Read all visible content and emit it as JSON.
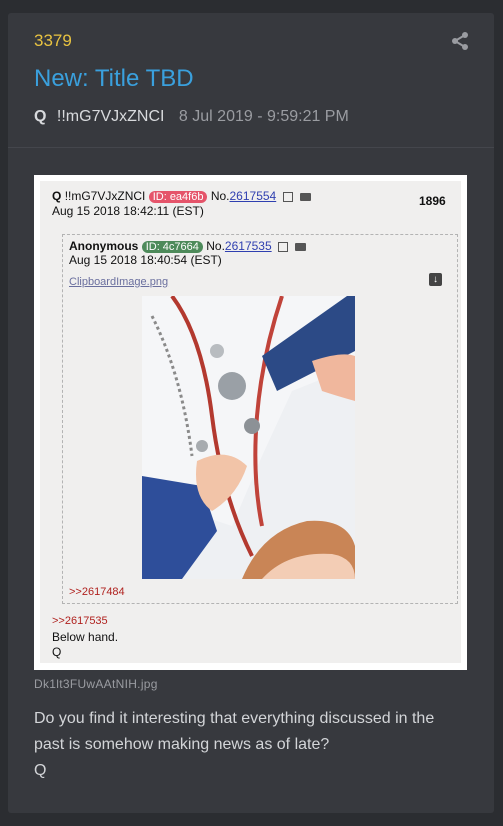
{
  "post": {
    "number": "3379",
    "title": "New: Title TBD",
    "author": "Q",
    "tripcode": "!!mG7VJxZNCI",
    "date": "8 Jul 2019 - 9:59:21 PM"
  },
  "icons": {
    "share": "share-icon",
    "download": "download-icon",
    "folder": "folder-icon",
    "external": "external-link-icon"
  },
  "screenshot": {
    "q_post": {
      "name": "Q",
      "trip": "!!mG7VJxZNCI",
      "id_label": "ID: ea4f6b",
      "no_label": "No.",
      "no_value": "2617554",
      "date": "Aug 15 2018 18:42:11 (EST)",
      "count": "1896"
    },
    "anon_post": {
      "name": "Anonymous",
      "id_label": "ID: 4c7664",
      "no_label": "No.",
      "no_value": "2617535",
      "date": "Aug 15 2018 18:40:54 (EST)",
      "file_link": "ClipboardImage.png",
      "reply_ref": ">>2617484"
    },
    "q_reply_ref": ">>2617535",
    "q_reply_line1": "Below hand.",
    "q_reply_line2": "Q"
  },
  "attachment_filename": "Dk1lt3FUwAAtNIH.jpg",
  "body": {
    "text": "Do you find it interesting that everything discussed in the past is somehow making news as of late?",
    "signature": "Q"
  },
  "colors": {
    "post_number": "#e8c341",
    "title": "#3aa0dd",
    "card_bg": "#37393e",
    "page_bg": "#2b2d31"
  }
}
